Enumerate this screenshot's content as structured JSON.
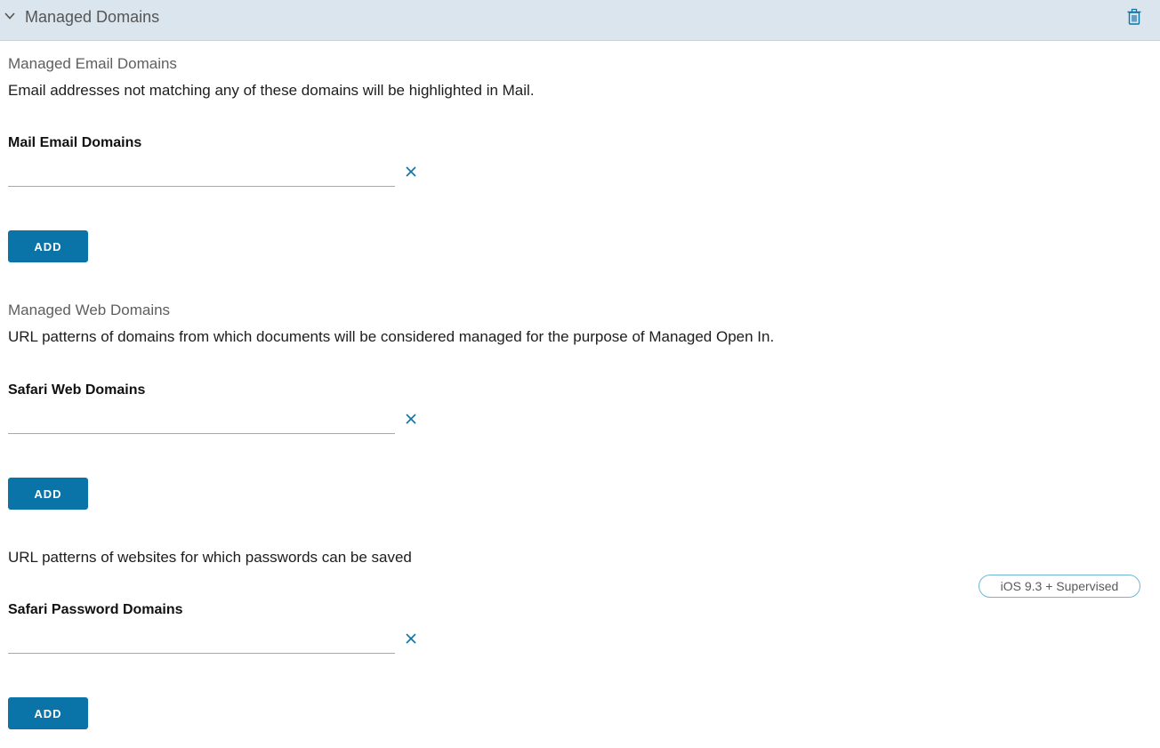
{
  "header": {
    "title": "Managed Domains",
    "collapse_icon": "chevron-down-icon",
    "delete_icon": "trash-icon"
  },
  "email_section": {
    "title": "Managed Email Domains",
    "description": "Email addresses not matching any of these domains will be highlighted in Mail.",
    "field_label": "Mail Email Domains",
    "input_value": "",
    "add_label": "ADD"
  },
  "web_section": {
    "title": "Managed Web Domains",
    "description": "URL patterns of domains from which documents will be considered managed for the purpose of Managed Open In.",
    "field_label": "Safari Web Domains",
    "input_value": "",
    "add_label": "ADD"
  },
  "password_section": {
    "description": "URL patterns of websites for which passwords can be saved",
    "badge": "iOS 9.3 + Supervised",
    "field_label": "Safari Password Domains",
    "input_value": "",
    "add_label": "ADD"
  },
  "colors": {
    "header_bg": "#dbe5ed",
    "accent": "#0a74a8",
    "badge_border": "#6fb7d4"
  }
}
